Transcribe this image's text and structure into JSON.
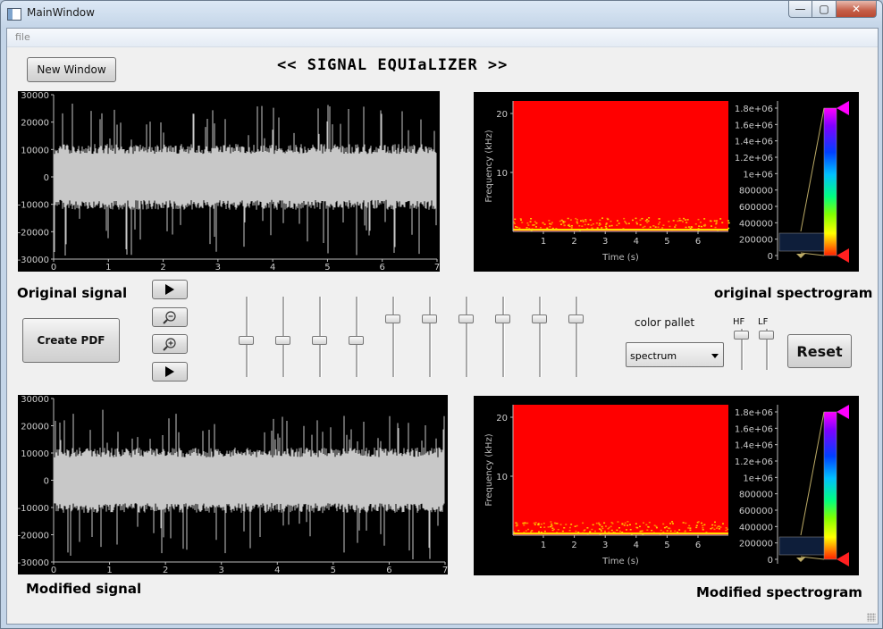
{
  "window": {
    "title": "MainWindow",
    "min": "—",
    "max": "▢",
    "close": "✕"
  },
  "menu": {
    "file": "file"
  },
  "buttons": {
    "new_window": "New Window",
    "create_pdf": "Create PDF",
    "reset": "Reset",
    "play": "▶",
    "zoom_out": "−",
    "zoom_in": "+"
  },
  "heading": "<< SIGNAL EQUIaLIZER >>",
  "labels": {
    "original_signal": "Original signal",
    "modified_signal": "Modified signal",
    "original_spectrogram": "original spectrogram",
    "modified_spectrogram": "Modified spectrogram",
    "color_pallet": "color pallet",
    "hf": "HF",
    "lf": "LF"
  },
  "combo": {
    "value": "spectrum"
  },
  "waveform_axis": {
    "y_ticks": [
      "30000",
      "20000",
      "10000",
      "0",
      "-10000",
      "-20000",
      "-30000"
    ],
    "x_ticks": [
      "0",
      "1",
      "2",
      "3",
      "4",
      "5",
      "6",
      "7"
    ]
  },
  "spectrogram_axis": {
    "y_ticks": [
      "20",
      "10"
    ],
    "x_ticks": [
      "1",
      "2",
      "3",
      "4",
      "5",
      "6"
    ],
    "ylabel": "Frequency (kHz)",
    "xlabel": "Time (s)",
    "colorbar_ticks": [
      "1.8e+06",
      "1.6e+06",
      "1.4e+06",
      "1.2e+06",
      "1e+06",
      "800000",
      "600000",
      "400000",
      "200000",
      "0"
    ]
  },
  "equalizer": {
    "slider_levels": [
      0.45,
      0.45,
      0.45,
      0.45,
      0.75,
      0.75,
      0.75,
      0.75,
      0.75,
      0.75
    ]
  },
  "hf_lf": {
    "hf_level": 0.95,
    "lf_level": 0.95
  },
  "colors": {
    "waveform": "#c8c8c8",
    "spectrogram": "#ff0000",
    "background": "#f0f0f0"
  }
}
